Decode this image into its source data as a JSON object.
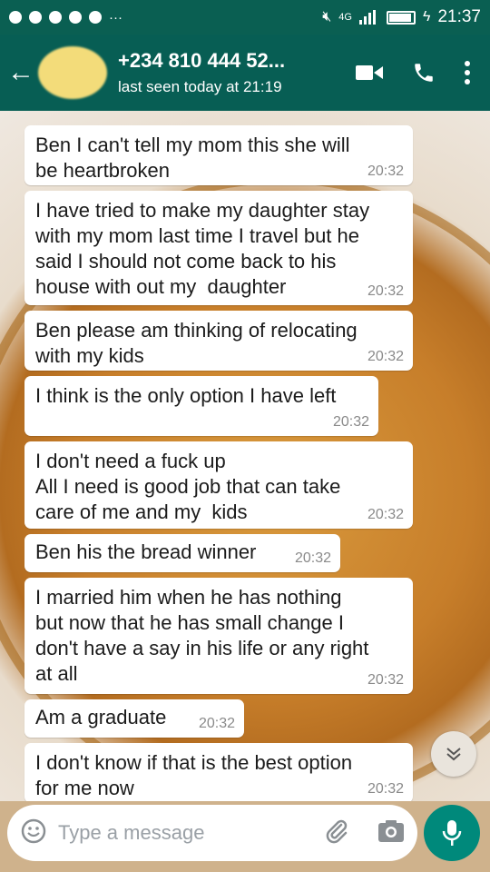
{
  "status_bar": {
    "network": "4G",
    "time": "21:37"
  },
  "header": {
    "contact_name": "+234 810 444 52...",
    "last_seen": "last seen today at 21:19"
  },
  "messages": [
    {
      "text": "Ben I can't tell my mom this she will\nbe heartbroken",
      "time": "20:32"
    },
    {
      "text": "I have tried to make my daughter stay\nwith my mom last time I travel but he\nsaid I should not come back to his\nhouse with out my  daughter",
      "time": "20:32"
    },
    {
      "text": "Ben please am thinking of relocating\nwith my kids",
      "time": "20:32"
    },
    {
      "text": "I think is the only option I have left",
      "time": "20:32"
    },
    {
      "text": "I don't need a fuck up\nAll I need is good job that can take\ncare of me and my  kids",
      "time": "20:32"
    },
    {
      "text": "Ben his the bread winner",
      "time": "20:32"
    },
    {
      "text": "I married him when he has nothing\nbut now that he has small change I\ndon't have a say in his life or any right\nat all",
      "time": "20:32"
    },
    {
      "text": "Am a graduate",
      "time": "20:32"
    },
    {
      "text": "I don't know if that is the best option\nfor me now",
      "time": "20:32"
    }
  ],
  "composer": {
    "placeholder": "Type a message"
  },
  "colors": {
    "header": "#075e54",
    "status": "#0a5f52",
    "accent": "#00897b"
  },
  "icons": [
    "back-arrow-icon",
    "video-call-icon",
    "phone-icon",
    "more-vert-icon",
    "emoji-icon",
    "attach-icon",
    "camera-icon",
    "mic-icon",
    "chevron-double-down-icon"
  ]
}
